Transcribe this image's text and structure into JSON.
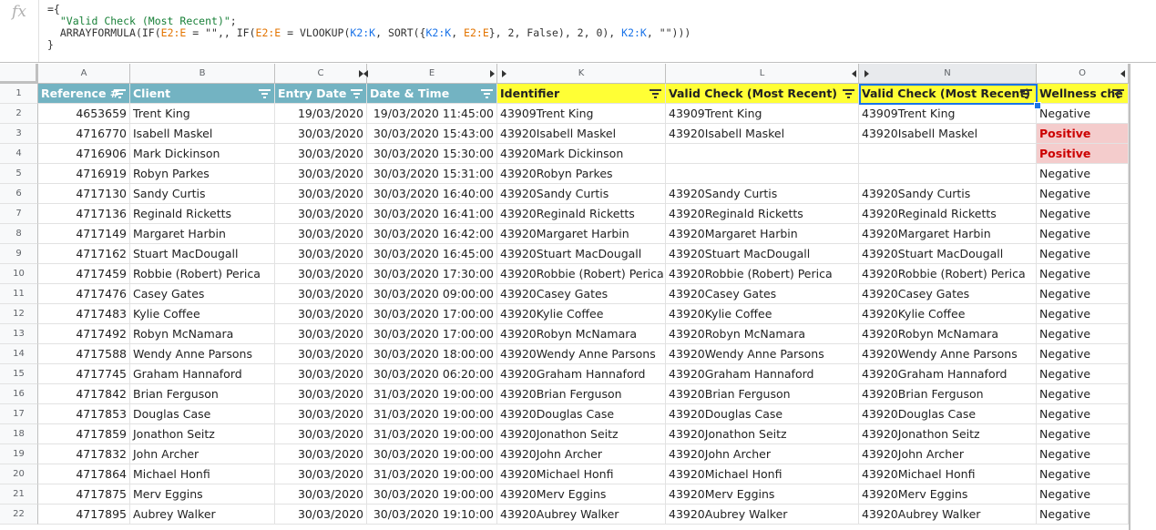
{
  "formula_bar": {
    "icon": "fx",
    "line1": "={",
    "line2_str": "\"Valid Check (Most Recent)\"",
    "line2_end": ";",
    "line3": [
      {
        "t": "ARRAYFORMULA(IF(",
        "c": ""
      },
      {
        "t": "E2:E",
        "c": "f-ref1"
      },
      {
        "t": " = \"\",, IF(",
        "c": ""
      },
      {
        "t": "E2:E",
        "c": "f-ref1"
      },
      {
        "t": " = VLOOKUP(",
        "c": ""
      },
      {
        "t": "K2:K",
        "c": "f-ref2"
      },
      {
        "t": ", SORT({",
        "c": ""
      },
      {
        "t": "K2:K",
        "c": "f-ref2"
      },
      {
        "t": ", ",
        "c": ""
      },
      {
        "t": "E2:E",
        "c": "f-ref1"
      },
      {
        "t": "}, 2, False), 2, 0), ",
        "c": ""
      },
      {
        "t": "K2:K",
        "c": "f-ref2"
      },
      {
        "t": ", \"\")))",
        "c": ""
      }
    ],
    "line4": "}"
  },
  "column_letters": [
    "A",
    "B",
    "C",
    "E",
    "K",
    "L",
    "N",
    "O"
  ],
  "headers": [
    "Reference #",
    "Client",
    "Entry Date",
    "Date & Time",
    "Identifier",
    "Valid Check (Most Recent)",
    "Valid Check (Most Recent)",
    "Wellness che"
  ],
  "colors": {
    "teal": "#73b3c2",
    "yellow": "#ffff35",
    "positive_bg": "#f4cccc",
    "positive_text": "#cc0000",
    "selection": "#1a73e8"
  },
  "rows": [
    {
      "n": "2",
      "ref": "4653659",
      "client": "Trent King",
      "entry": "19/03/2020",
      "dt": "19/03/2020 11:45:00",
      "id": "43909Trent King",
      "l": "43909Trent King",
      "nn": "43909Trent King",
      "o": "Negative"
    },
    {
      "n": "3",
      "ref": "4716770",
      "client": "Isabell Maskel",
      "entry": "30/03/2020",
      "dt": "30/03/2020 15:43:00",
      "id": "43920Isabell Maskel",
      "l": "43920Isabell Maskel",
      "nn": "43920Isabell Maskel",
      "o": "Positive"
    },
    {
      "n": "4",
      "ref": "4716906",
      "client": "Mark Dickinson",
      "entry": "30/03/2020",
      "dt": "30/03/2020 15:30:00",
      "id": "43920Mark Dickinson",
      "l": "",
      "nn": "",
      "o": "Positive"
    },
    {
      "n": "5",
      "ref": "4716919",
      "client": "Robyn Parkes",
      "entry": "30/03/2020",
      "dt": "30/03/2020 15:31:00",
      "id": "43920Robyn Parkes",
      "l": "",
      "nn": "",
      "o": "Negative"
    },
    {
      "n": "6",
      "ref": "4717130",
      "client": "Sandy Curtis",
      "entry": "30/03/2020",
      "dt": "30/03/2020 16:40:00",
      "id": "43920Sandy Curtis",
      "l": "43920Sandy Curtis",
      "nn": "43920Sandy Curtis",
      "o": "Negative"
    },
    {
      "n": "7",
      "ref": "4717136",
      "client": "Reginald Ricketts",
      "entry": "30/03/2020",
      "dt": "30/03/2020 16:41:00",
      "id": "43920Reginald Ricketts",
      "l": "43920Reginald Ricketts",
      "nn": "43920Reginald Ricketts",
      "o": "Negative"
    },
    {
      "n": "8",
      "ref": "4717149",
      "client": "Margaret Harbin",
      "entry": "30/03/2020",
      "dt": "30/03/2020 16:42:00",
      "id": "43920Margaret Harbin",
      "l": "43920Margaret Harbin",
      "nn": "43920Margaret Harbin",
      "o": "Negative"
    },
    {
      "n": "9",
      "ref": "4717162",
      "client": "Stuart MacDougall",
      "entry": "30/03/2020",
      "dt": "30/03/2020 16:45:00",
      "id": "43920Stuart MacDougall",
      "l": "43920Stuart MacDougall",
      "nn": "43920Stuart MacDougall",
      "o": "Negative"
    },
    {
      "n": "10",
      "ref": "4717459",
      "client": "Robbie (Robert) Perica",
      "entry": "30/03/2020",
      "dt": "30/03/2020 17:30:00",
      "id": "43920Robbie (Robert) Perica",
      "l": "43920Robbie (Robert) Perica",
      "nn": "43920Robbie (Robert) Perica",
      "o": "Negative"
    },
    {
      "n": "11",
      "ref": "4717476",
      "client": "Casey Gates",
      "entry": "30/03/2020",
      "dt": "30/03/2020 09:00:00",
      "id": "43920Casey Gates",
      "l": "43920Casey Gates",
      "nn": "43920Casey Gates",
      "o": "Negative"
    },
    {
      "n": "12",
      "ref": "4717483",
      "client": "Kylie Coffee",
      "entry": "30/03/2020",
      "dt": "30/03/2020 17:00:00",
      "id": "43920Kylie Coffee",
      "l": "43920Kylie Coffee",
      "nn": "43920Kylie Coffee",
      "o": "Negative"
    },
    {
      "n": "13",
      "ref": "4717492",
      "client": "Robyn McNamara",
      "entry": "30/03/2020",
      "dt": "30/03/2020 17:00:00",
      "id": "43920Robyn McNamara",
      "l": "43920Robyn McNamara",
      "nn": "43920Robyn McNamara",
      "o": "Negative"
    },
    {
      "n": "14",
      "ref": "4717588",
      "client": "Wendy Anne Parsons",
      "entry": "30/03/2020",
      "dt": "30/03/2020 18:00:00",
      "id": "43920Wendy Anne Parsons",
      "l": "43920Wendy Anne Parsons",
      "nn": "43920Wendy Anne Parsons",
      "o": "Negative"
    },
    {
      "n": "15",
      "ref": "4717745",
      "client": "Graham Hannaford",
      "entry": "30/03/2020",
      "dt": "30/03/2020 06:20:00",
      "id": "43920Graham Hannaford",
      "l": "43920Graham Hannaford",
      "nn": "43920Graham Hannaford",
      "o": "Negative"
    },
    {
      "n": "16",
      "ref": "4717842",
      "client": "Brian Ferguson",
      "entry": "30/03/2020",
      "dt": "31/03/2020 19:00:00",
      "id": "43920Brian Ferguson",
      "l": "43920Brian Ferguson",
      "nn": "43920Brian Ferguson",
      "o": "Negative"
    },
    {
      "n": "17",
      "ref": "4717853",
      "client": "Douglas Case",
      "entry": "30/03/2020",
      "dt": "31/03/2020 19:00:00",
      "id": "43920Douglas Case",
      "l": "43920Douglas Case",
      "nn": "43920Douglas Case",
      "o": "Negative"
    },
    {
      "n": "18",
      "ref": "4717859",
      "client": "Jonathon Seitz",
      "entry": "30/03/2020",
      "dt": "31/03/2020 19:00:00",
      "id": "43920Jonathon Seitz",
      "l": "43920Jonathon Seitz",
      "nn": "43920Jonathon Seitz",
      "o": "Negative"
    },
    {
      "n": "19",
      "ref": "4717832",
      "client": "John Archer",
      "entry": "30/03/2020",
      "dt": "30/03/2020 19:00:00",
      "id": "43920John Archer",
      "l": "43920John Archer",
      "nn": "43920John Archer",
      "o": "Negative"
    },
    {
      "n": "20",
      "ref": "4717864",
      "client": "Michael Honfi",
      "entry": "30/03/2020",
      "dt": "31/03/2020 19:00:00",
      "id": "43920Michael Honfi",
      "l": "43920Michael Honfi",
      "nn": "43920Michael Honfi",
      "o": "Negative"
    },
    {
      "n": "21",
      "ref": "4717875",
      "client": "Merv Eggins",
      "entry": "30/03/2020",
      "dt": "30/03/2020 19:00:00",
      "id": "43920Merv Eggins",
      "l": "43920Merv Eggins",
      "nn": "43920Merv Eggins",
      "o": "Negative"
    },
    {
      "n": "22",
      "ref": "4717895",
      "client": "Aubrey Walker",
      "entry": "30/03/2020",
      "dt": "30/03/2020 19:10:00",
      "id": "43920Aubrey Walker",
      "l": "43920Aubrey Walker",
      "nn": "43920Aubrey Walker",
      "o": "Negative"
    }
  ]
}
